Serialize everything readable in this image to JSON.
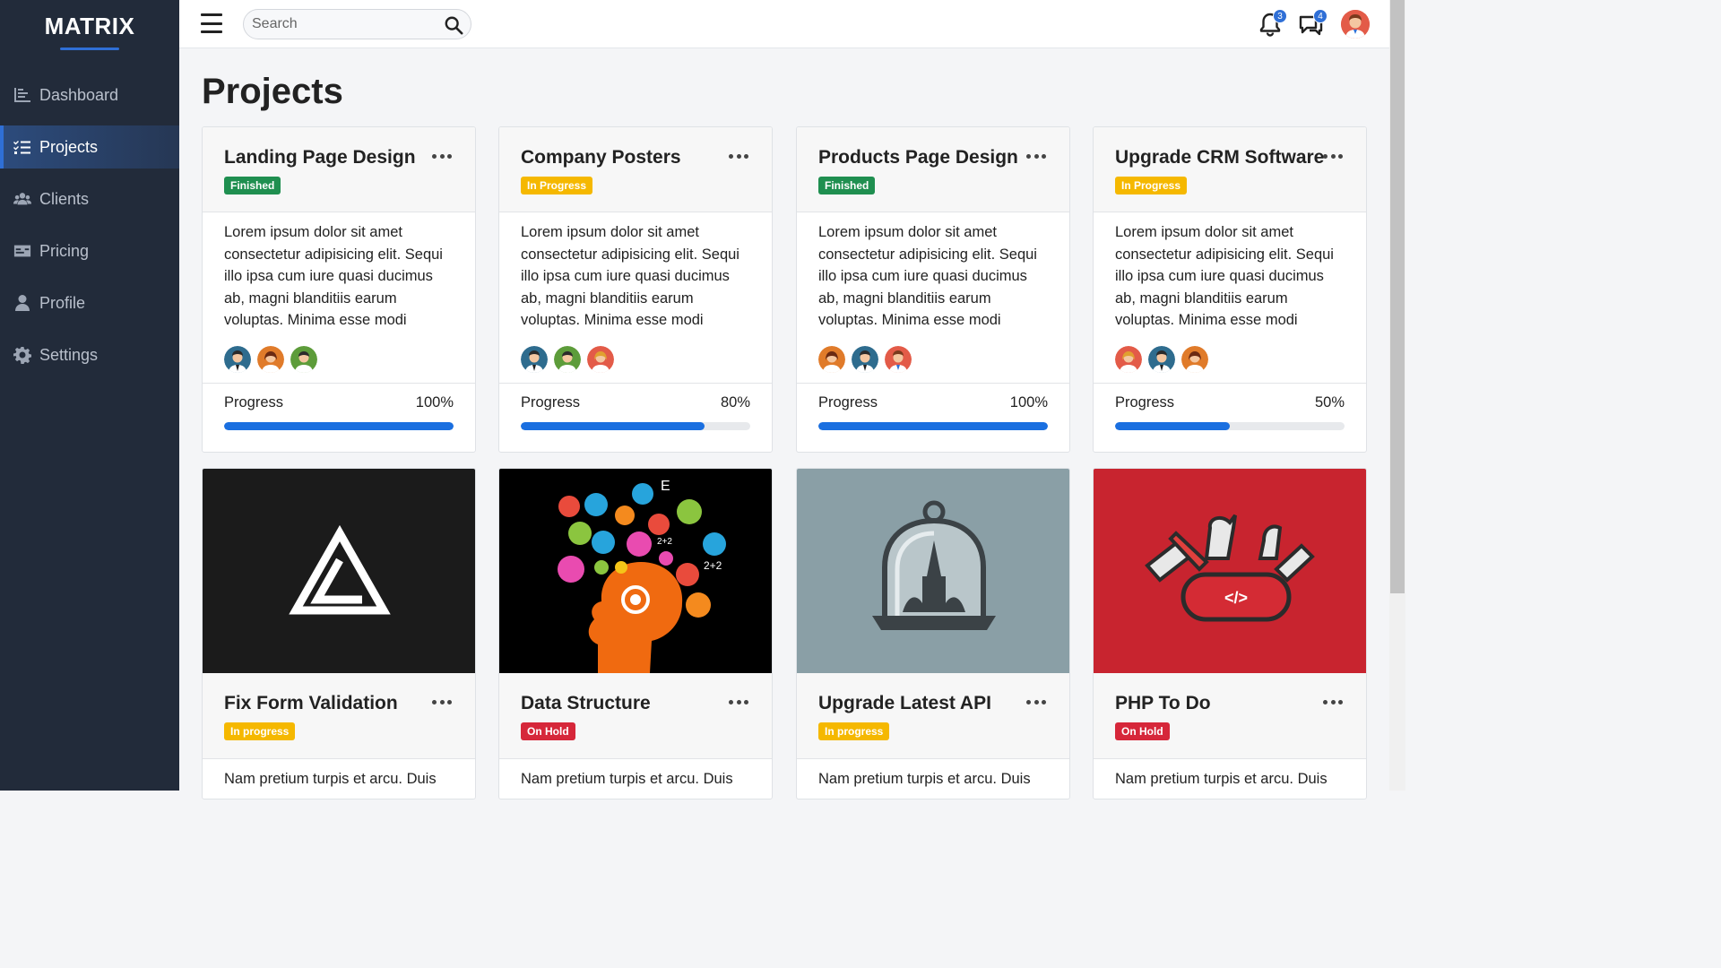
{
  "app": {
    "logo": "MATRIX"
  },
  "sidebar": {
    "items": [
      {
        "label": "Dashboard",
        "icon": "chart-icon"
      },
      {
        "label": "Projects",
        "icon": "list-icon",
        "active": true
      },
      {
        "label": "Clients",
        "icon": "users-icon"
      },
      {
        "label": "Pricing",
        "icon": "card-icon"
      },
      {
        "label": "Profile",
        "icon": "user-icon"
      },
      {
        "label": "Settings",
        "icon": "gear-icon"
      }
    ]
  },
  "topbar": {
    "search_placeholder": "Search",
    "notifications_count": "3",
    "messages_count": "4"
  },
  "page": {
    "title": "Projects"
  },
  "projects": [
    {
      "title": "Landing Page Design",
      "status": "Finished",
      "status_color": "#1f8f50",
      "desc": "Lorem ipsum dolor sit amet consectetur adipisicing elit. Sequi illo ipsa cum iure quasi ducimus ab, magni blanditiis earum voluptas. Minima esse modi",
      "progress_label": "Progress",
      "progress_text": "100%",
      "progress": 100
    },
    {
      "title": "Company Posters",
      "status": "In Progress",
      "status_color": "#f5b800",
      "desc": "Lorem ipsum dolor sit amet consectetur adipisicing elit. Sequi illo ipsa cum iure quasi ducimus ab, magni blanditiis earum voluptas. Minima esse modi",
      "progress_label": "Progress",
      "progress_text": "80%",
      "progress": 80
    },
    {
      "title": "Products Page Design",
      "status": "Finished",
      "status_color": "#1f8f50",
      "desc": "Lorem ipsum dolor sit amet consectetur adipisicing elit. Sequi illo ipsa cum iure quasi ducimus ab, magni blanditiis earum voluptas. Minima esse modi",
      "progress_label": "Progress",
      "progress_text": "100%",
      "progress": 100
    },
    {
      "title": "Upgrade CRM Software",
      "status": "In Progress",
      "status_color": "#f5b800",
      "desc": "Lorem ipsum dolor sit amet consectetur adipisicing elit. Sequi illo ipsa cum iure quasi ducimus ab, magni blanditiis earum voluptas. Minima esse modi",
      "progress_label": "Progress",
      "progress_text": "50%",
      "progress": 50
    }
  ],
  "tasks": [
    {
      "title": "Fix Form Validation",
      "status": "In progress",
      "status_color": "#f5b800",
      "desc": "Nam pretium turpis et arcu. Duis",
      "image": "a-logo-image"
    },
    {
      "title": "Data Structure",
      "status": "On Hold",
      "status_color": "#d6273a",
      "desc": "Nam pretium turpis et arcu. Duis",
      "image": "brain-ideas-image"
    },
    {
      "title": "Upgrade Latest API",
      "status": "In progress",
      "status_color": "#f5b800",
      "desc": "Nam pretium turpis et arcu. Duis",
      "image": "bell-jar-image"
    },
    {
      "title": "PHP To Do",
      "status": "On Hold",
      "status_color": "#d6273a",
      "desc": "Nam pretium turpis et arcu. Duis",
      "image": "swiss-knife-image"
    }
  ]
}
